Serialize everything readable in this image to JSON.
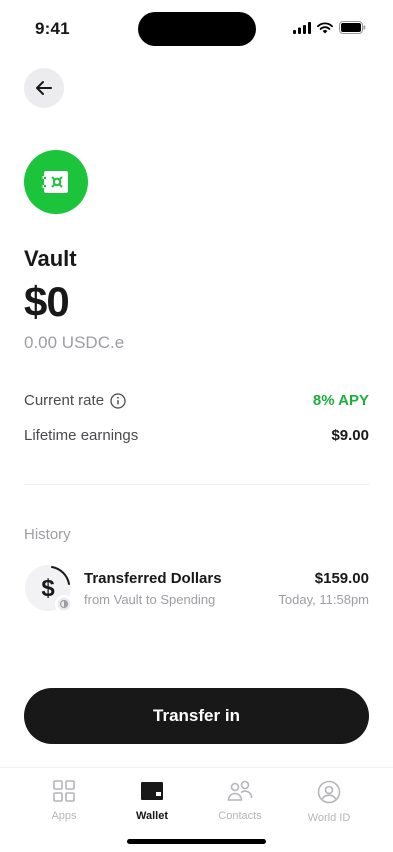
{
  "status": {
    "time": "9:41"
  },
  "vault": {
    "title": "Vault",
    "balance": "$0",
    "token_balance": "0.00 USDC.e"
  },
  "stats": {
    "rate_label": "Current rate",
    "rate_value": "8% APY",
    "earnings_label": "Lifetime earnings",
    "earnings_value": "$9.00"
  },
  "history": {
    "heading": "History",
    "items": [
      {
        "title": "Transferred Dollars",
        "subtitle": "from Vault to Spending",
        "amount": "$159.00",
        "time": "Today, 11:58pm"
      }
    ]
  },
  "actions": {
    "transfer_label": "Transfer in"
  },
  "tabs": [
    {
      "label": "Apps",
      "icon": "grid-icon"
    },
    {
      "label": "Wallet",
      "icon": "wallet-icon",
      "active": true
    },
    {
      "label": "Contacts",
      "icon": "contacts-icon"
    },
    {
      "label": "World ID",
      "icon": "user-circle-icon"
    }
  ],
  "colors": {
    "accent_green": "#1cc43c",
    "apy_green": "#1cae3c",
    "button_dark": "#181818"
  }
}
